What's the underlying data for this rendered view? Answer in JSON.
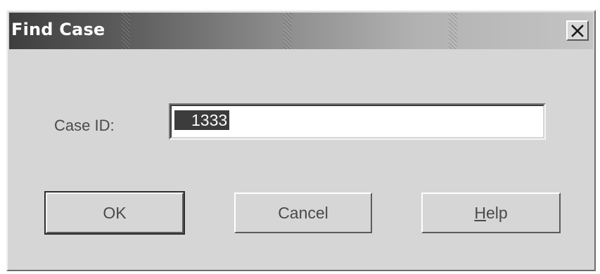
{
  "dialog": {
    "title": "Find Case"
  },
  "form": {
    "case_id_label": "Case ID:",
    "case_id_value": "1333"
  },
  "buttons": {
    "ok_label": "OK",
    "cancel_label": "Cancel",
    "help_accel": "H",
    "help_rest": "elp"
  },
  "icons": {
    "close": "close-icon"
  }
}
